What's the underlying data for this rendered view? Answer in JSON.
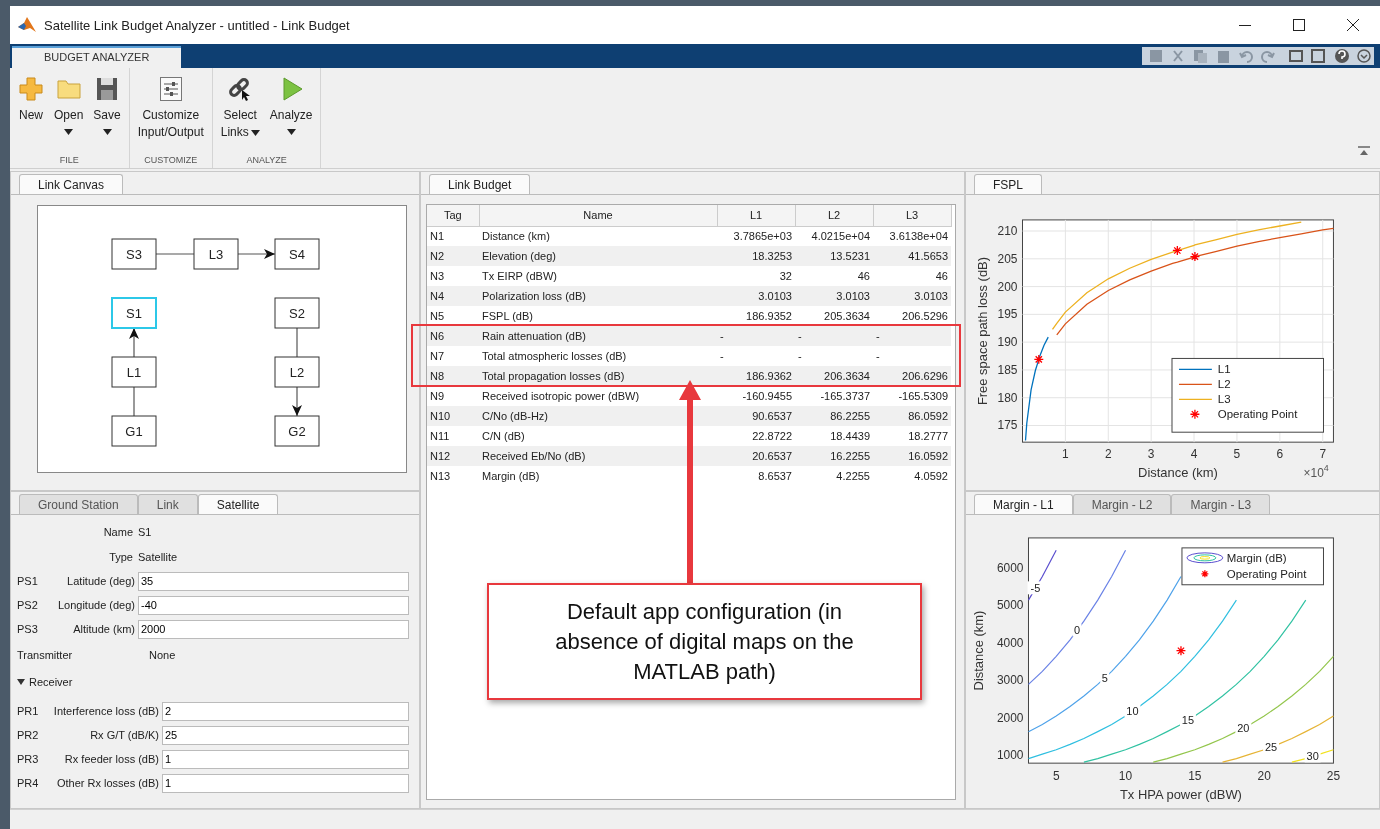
{
  "window": {
    "title": "Satellite Link Budget Analyzer - untitled - Link Budget"
  },
  "ribbon": {
    "tabs": [
      {
        "label": "BUDGET ANALYZER",
        "selected": true
      }
    ],
    "groups": [
      {
        "label": "FILE",
        "buttons": [
          {
            "kind": "new",
            "lines": [
              "New"
            ],
            "has_menu": false
          },
          {
            "kind": "open",
            "lines": [
              "Open"
            ],
            "has_menu": true
          },
          {
            "kind": "save",
            "lines": [
              "Save"
            ],
            "has_menu": true
          }
        ]
      },
      {
        "label": "CUSTOMIZE",
        "buttons": [
          {
            "kind": "customize",
            "lines": [
              "Customize",
              "Input/Output"
            ],
            "has_menu": false
          }
        ]
      },
      {
        "label": "ANALYZE",
        "buttons": [
          {
            "kind": "select",
            "lines": [
              "Select",
              "Links"
            ],
            "has_menu": true
          },
          {
            "kind": "analyze",
            "lines": [
              "Analyze"
            ],
            "has_menu": true
          }
        ]
      }
    ]
  },
  "link_canvas": {
    "tab": {
      "label": "Link Canvas",
      "selected": true
    },
    "rows": [
      {
        "left": {
          "label": "S3",
          "kind": "right",
          "selected": false
        },
        "center": {
          "label": "L3",
          "kind": "right",
          "head": true,
          "selected": false
        },
        "right": {
          "label": "S4",
          "kind": "end",
          "selected": false
        }
      },
      {
        "left": {
          "label": "S1",
          "kind": "end",
          "selected": true
        },
        "right": {
          "label": "S2",
          "kind": "down",
          "selected": false
        }
      },
      {
        "left": {
          "label": "L1",
          "kind": "up",
          "head": true,
          "selected": false
        },
        "right": {
          "label": "L2",
          "kind": "down",
          "head": true,
          "selected": false
        }
      },
      {
        "left": {
          "label": "G1",
          "kind": "up",
          "selected": false
        },
        "right": {
          "label": "G2",
          "kind": "end",
          "selected": false
        }
      }
    ]
  },
  "properties": {
    "tabs": [
      {
        "label": "Ground Station",
        "selected": false
      },
      {
        "label": "Link",
        "selected": false
      },
      {
        "label": "Satellite",
        "selected": true
      }
    ],
    "info": [
      {
        "label": "Name",
        "value": "S1"
      },
      {
        "label": "Type",
        "value": "Satellite"
      }
    ],
    "fields": [
      {
        "tag": "PS1",
        "label": "Latitude (deg)",
        "value": "35"
      },
      {
        "tag": "PS2",
        "label": "Longitude (deg)",
        "value": "-40"
      },
      {
        "tag": "PS3",
        "label": "Altitude (km)",
        "value": "2000"
      }
    ],
    "transmitter": {
      "label": "Transmitter",
      "value": "None"
    },
    "receiver": {
      "label": "Receiver",
      "expanded": true,
      "fields": [
        {
          "tag": "PR1",
          "label": "Interference loss (dB)",
          "value": "2"
        },
        {
          "tag": "PR2",
          "label": "Rx G/T (dB/K)",
          "value": "25"
        },
        {
          "tag": "PR3",
          "label": "Rx feeder loss (dB)",
          "value": "1"
        },
        {
          "tag": "PR4",
          "label": "Other Rx losses (dB)",
          "value": "1"
        }
      ]
    }
  },
  "link_budget": {
    "tab": {
      "label": "Link Budget",
      "selected": true
    },
    "columns": [
      "Tag",
      "Name",
      "L1",
      "L2",
      "L3"
    ],
    "rows": [
      {
        "kind": "numeric",
        "highlighted": false,
        "cells": [
          "N1",
          "Distance (km)",
          "3.7865e+03",
          "4.0215e+04",
          "3.6138e+04"
        ]
      },
      {
        "kind": "numeric",
        "highlighted": false,
        "cells": [
          "N2",
          "Elevation (deg)",
          "18.3253",
          "13.5231",
          "41.5653"
        ]
      },
      {
        "kind": "numeric",
        "highlighted": false,
        "cells": [
          "N3",
          "Tx EIRP (dBW)",
          "32",
          "46",
          "46"
        ]
      },
      {
        "kind": "numeric",
        "highlighted": false,
        "cells": [
          "N4",
          "Polarization loss (dB)",
          "3.0103",
          "3.0103",
          "3.0103"
        ]
      },
      {
        "kind": "numeric",
        "highlighted": false,
        "cells": [
          "N5",
          "FSPL (dB)",
          "186.9352",
          "205.3634",
          "206.5296"
        ]
      },
      {
        "kind": "text",
        "highlighted": true,
        "cells": [
          "N6",
          "Rain attenuation (dB)",
          "-",
          "-",
          "-"
        ]
      },
      {
        "kind": "text",
        "highlighted": true,
        "cells": [
          "N7",
          "Total atmospheric losses (dB)",
          "-",
          "-",
          "-"
        ]
      },
      {
        "kind": "numeric",
        "highlighted": true,
        "cells": [
          "N8",
          "Total propagation losses (dB)",
          "186.9362",
          "206.3634",
          "206.6296"
        ]
      },
      {
        "kind": "numeric",
        "highlighted": false,
        "cells": [
          "N9",
          "Received isotropic power (dBW)",
          "-160.9455",
          "-165.3737",
          "-165.5309"
        ]
      },
      {
        "kind": "numeric",
        "highlighted": false,
        "cells": [
          "N10",
          "C/No (dB-Hz)",
          "90.6537",
          "86.2255",
          "86.0592"
        ]
      },
      {
        "kind": "numeric",
        "highlighted": false,
        "cells": [
          "N11",
          "C/N (dB)",
          "22.8722",
          "18.4439",
          "18.2777"
        ]
      },
      {
        "kind": "numeric",
        "highlighted": false,
        "cells": [
          "N12",
          "Received Eb/No (dB)",
          "20.6537",
          "16.2255",
          "16.0592"
        ]
      },
      {
        "kind": "numeric",
        "highlighted": false,
        "cells": [
          "N13",
          "Margin (dB)",
          "8.6537",
          "4.2255",
          "4.0592"
        ]
      }
    ]
  },
  "fspl": {
    "tab": {
      "label": "FSPL",
      "selected": true
    },
    "axis_multiplier": {
      "base": "×10",
      "exponent": "4"
    },
    "chart_data": {
      "type": "line",
      "xlabel": "Distance (km)",
      "ylabel": "Free space path loss (dB)",
      "grid": true,
      "legend": "lower right",
      "x": [
        0.07,
        0.1,
        0.2,
        0.3,
        0.38,
        0.4,
        0.5,
        0.6,
        0.7,
        0.8,
        1,
        1.5,
        2,
        2.5,
        3,
        3.5,
        3.61,
        4,
        4.02,
        4.5,
        5,
        5.5,
        6,
        6.5,
        7,
        7.25
      ],
      "series": [
        {
          "name": "L1",
          "color": "#0072bd",
          "values": [
            172.3,
            175.4,
            181.4,
            184.9,
            186.9,
            187.4,
            189.4,
            190.9,
            null,
            null,
            null,
            null,
            null,
            null,
            null,
            null,
            null,
            null,
            null,
            null,
            null,
            null,
            null,
            null,
            null,
            null
          ]
        },
        {
          "name": "L2",
          "color": "#d95319",
          "values": [
            null,
            null,
            null,
            null,
            null,
            null,
            null,
            null,
            null,
            191.3,
            193.3,
            196.8,
            199.3,
            201.2,
            202.8,
            204.2,
            204.4,
            205.3,
            205.4,
            206.3,
            207.3,
            208.1,
            208.8,
            209.5,
            210.2,
            210.5
          ]
        },
        {
          "name": "L3",
          "color": "#edb120",
          "values": [
            null,
            null,
            null,
            null,
            null,
            null,
            null,
            null,
            192.3,
            193.4,
            195.4,
            198.9,
            201.4,
            203.3,
            204.9,
            206.2,
            206.5,
            207.4,
            207.5,
            208.4,
            209.4,
            210.2,
            210.9,
            211.6,
            null,
            null
          ]
        },
        {
          "name": "Operating Point",
          "color": "#ff0000",
          "marker": "cross",
          "values": [
            null,
            null,
            null,
            null,
            186.9,
            null,
            null,
            null,
            null,
            null,
            null,
            null,
            null,
            null,
            null,
            null,
            206.5,
            null,
            205.4,
            null,
            null,
            null,
            null,
            null,
            null,
            null
          ]
        }
      ],
      "xlim": [
        0,
        7.25
      ],
      "ylim": [
        172,
        212
      ],
      "xticks": [
        1,
        2,
        3,
        4,
        5,
        6,
        7
      ],
      "yticks": [
        175,
        180,
        185,
        190,
        195,
        200,
        205,
        210
      ]
    }
  },
  "margin": {
    "tabs": [
      {
        "label": "Margin - L1",
        "selected": true
      },
      {
        "label": "Margin - L2",
        "selected": false
      },
      {
        "label": "Margin - L3",
        "selected": false
      }
    ],
    "legend_label": "Margin (dB)",
    "chart_data": {
      "type": "line",
      "xlabel": "Tx HPA power (dBW)",
      "ylabel": "Distance (km)",
      "grid": false,
      "legend": "upper right",
      "x": [
        3,
        4,
        5,
        6,
        7,
        8,
        9,
        10,
        11,
        12,
        13,
        14,
        15,
        16,
        17,
        18,
        19,
        20,
        21,
        22,
        23,
        24,
        25
      ],
      "series": [
        {
          "name": "-5",
          "color": "#5b4fcf",
          "values": [
            5140,
            5770,
            6470,
            null,
            null,
            null,
            null,
            null,
            null,
            null,
            null,
            null,
            null,
            null,
            null,
            null,
            null,
            null,
            null,
            null,
            null,
            null,
            null
          ]
        },
        {
          "name": "0",
          "color": "#6a82e6",
          "values": [
            2890,
            3240,
            3640,
            4080,
            4580,
            5140,
            5770,
            6470,
            null,
            null,
            null,
            null,
            null,
            null,
            null,
            null,
            null,
            null,
            null,
            null,
            null,
            null,
            null
          ]
        },
        {
          "name": "5",
          "color": "#4ea2ea",
          "values": [
            1630,
            1820,
            2050,
            2300,
            2580,
            2890,
            3240,
            3640,
            4080,
            4580,
            5140,
            5770,
            null,
            null,
            null,
            null,
            null,
            null,
            null,
            null,
            null,
            null,
            null
          ]
        },
        {
          "name": "10",
          "color": "#2fbfe0",
          "values": [
            910,
            1030,
            1150,
            1290,
            1450,
            1630,
            1820,
            2050,
            2300,
            2580,
            2890,
            3240,
            3640,
            4080,
            4580,
            5140,
            null,
            null,
            null,
            null,
            null,
            null,
            null
          ]
        },
        {
          "name": "15",
          "color": "#30c2a2",
          "values": [
            null,
            null,
            null,
            null,
            820,
            910,
            1030,
            1150,
            1290,
            1450,
            1630,
            1820,
            2050,
            2300,
            2580,
            2890,
            3240,
            3640,
            4080,
            4580,
            5140,
            null,
            null
          ]
        },
        {
          "name": "20",
          "color": "#93c64c",
          "values": [
            null,
            null,
            null,
            null,
            null,
            null,
            null,
            null,
            null,
            820,
            910,
            1030,
            1150,
            1290,
            1450,
            1630,
            1820,
            2050,
            2300,
            2580,
            2890,
            3240,
            3640
          ]
        },
        {
          "name": "25",
          "color": "#e6b435",
          "values": [
            null,
            null,
            null,
            null,
            null,
            null,
            null,
            null,
            null,
            null,
            null,
            null,
            null,
            null,
            820,
            910,
            1030,
            1150,
            1290,
            1450,
            1630,
            1820,
            2050
          ]
        },
        {
          "name": "30",
          "color": "#f2e21e",
          "values": [
            null,
            null,
            null,
            null,
            null,
            null,
            null,
            null,
            null,
            null,
            null,
            null,
            null,
            null,
            null,
            null,
            null,
            null,
            null,
            820,
            910,
            1030,
            1150
          ]
        },
        {
          "name": "Operating Point",
          "color": "#ff0000",
          "marker": "cross",
          "values": [
            null,
            null,
            null,
            null,
            null,
            null,
            null,
            null,
            null,
            null,
            null,
            3790,
            null,
            null,
            null,
            null,
            null,
            null,
            null,
            null,
            null,
            null,
            null
          ]
        }
      ],
      "xlim": [
        3,
        25
      ],
      "ylim": [
        790,
        6800
      ],
      "xticks": [
        5,
        10,
        15,
        20,
        25
      ],
      "yticks": [
        1000,
        2000,
        3000,
        4000,
        5000,
        6000
      ]
    }
  },
  "callout": {
    "text": "Default app configuration (in absence of digital maps on the MATLAB path)"
  }
}
